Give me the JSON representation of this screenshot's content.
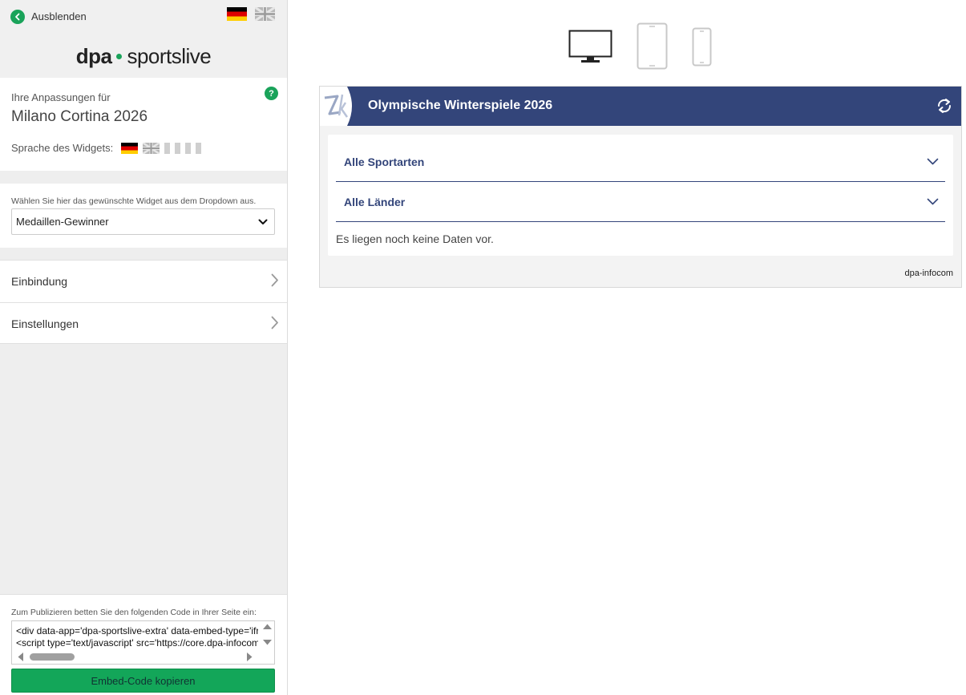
{
  "sidebar": {
    "hide_label": "Ausblenden",
    "logo_part1": "dpa",
    "logo_part2": "sportslive",
    "intro": "Ihre Anpassungen für",
    "event_title": "Milano Cortina 2026",
    "language_label": "Sprache des Widgets:",
    "help_label": "?",
    "widget_hint": "Wählen Sie hier das gewünschte Widget aus dem Dropdown aus.",
    "widget_selected": "Medaillen-Gewinner",
    "accordion": [
      {
        "label": "Einbindung"
      },
      {
        "label": "Einstellungen"
      }
    ],
    "publish_hint": "Zum Publizieren betten Sie den folgenden Code in Ihrer Seite ein:",
    "code_lines": [
      "<div data-app='dpa-sportslive-extra' data-embed-type='iframe'",
      "<script type='text/javascript' src='https://core.dpa-infocom"
    ],
    "copy_label": "Embed-Code kopieren"
  },
  "preview": {
    "widget_title": "Olympische Winterspiele 2026",
    "filters": [
      {
        "label": "Alle Sportarten"
      },
      {
        "label": "Alle Länder"
      }
    ],
    "empty_message": "Es liegen noch keine Daten vor.",
    "footer": "dpa-infocom"
  },
  "colors": {
    "accent_green": "#1aa35a",
    "widget_navy": "#33457a"
  }
}
